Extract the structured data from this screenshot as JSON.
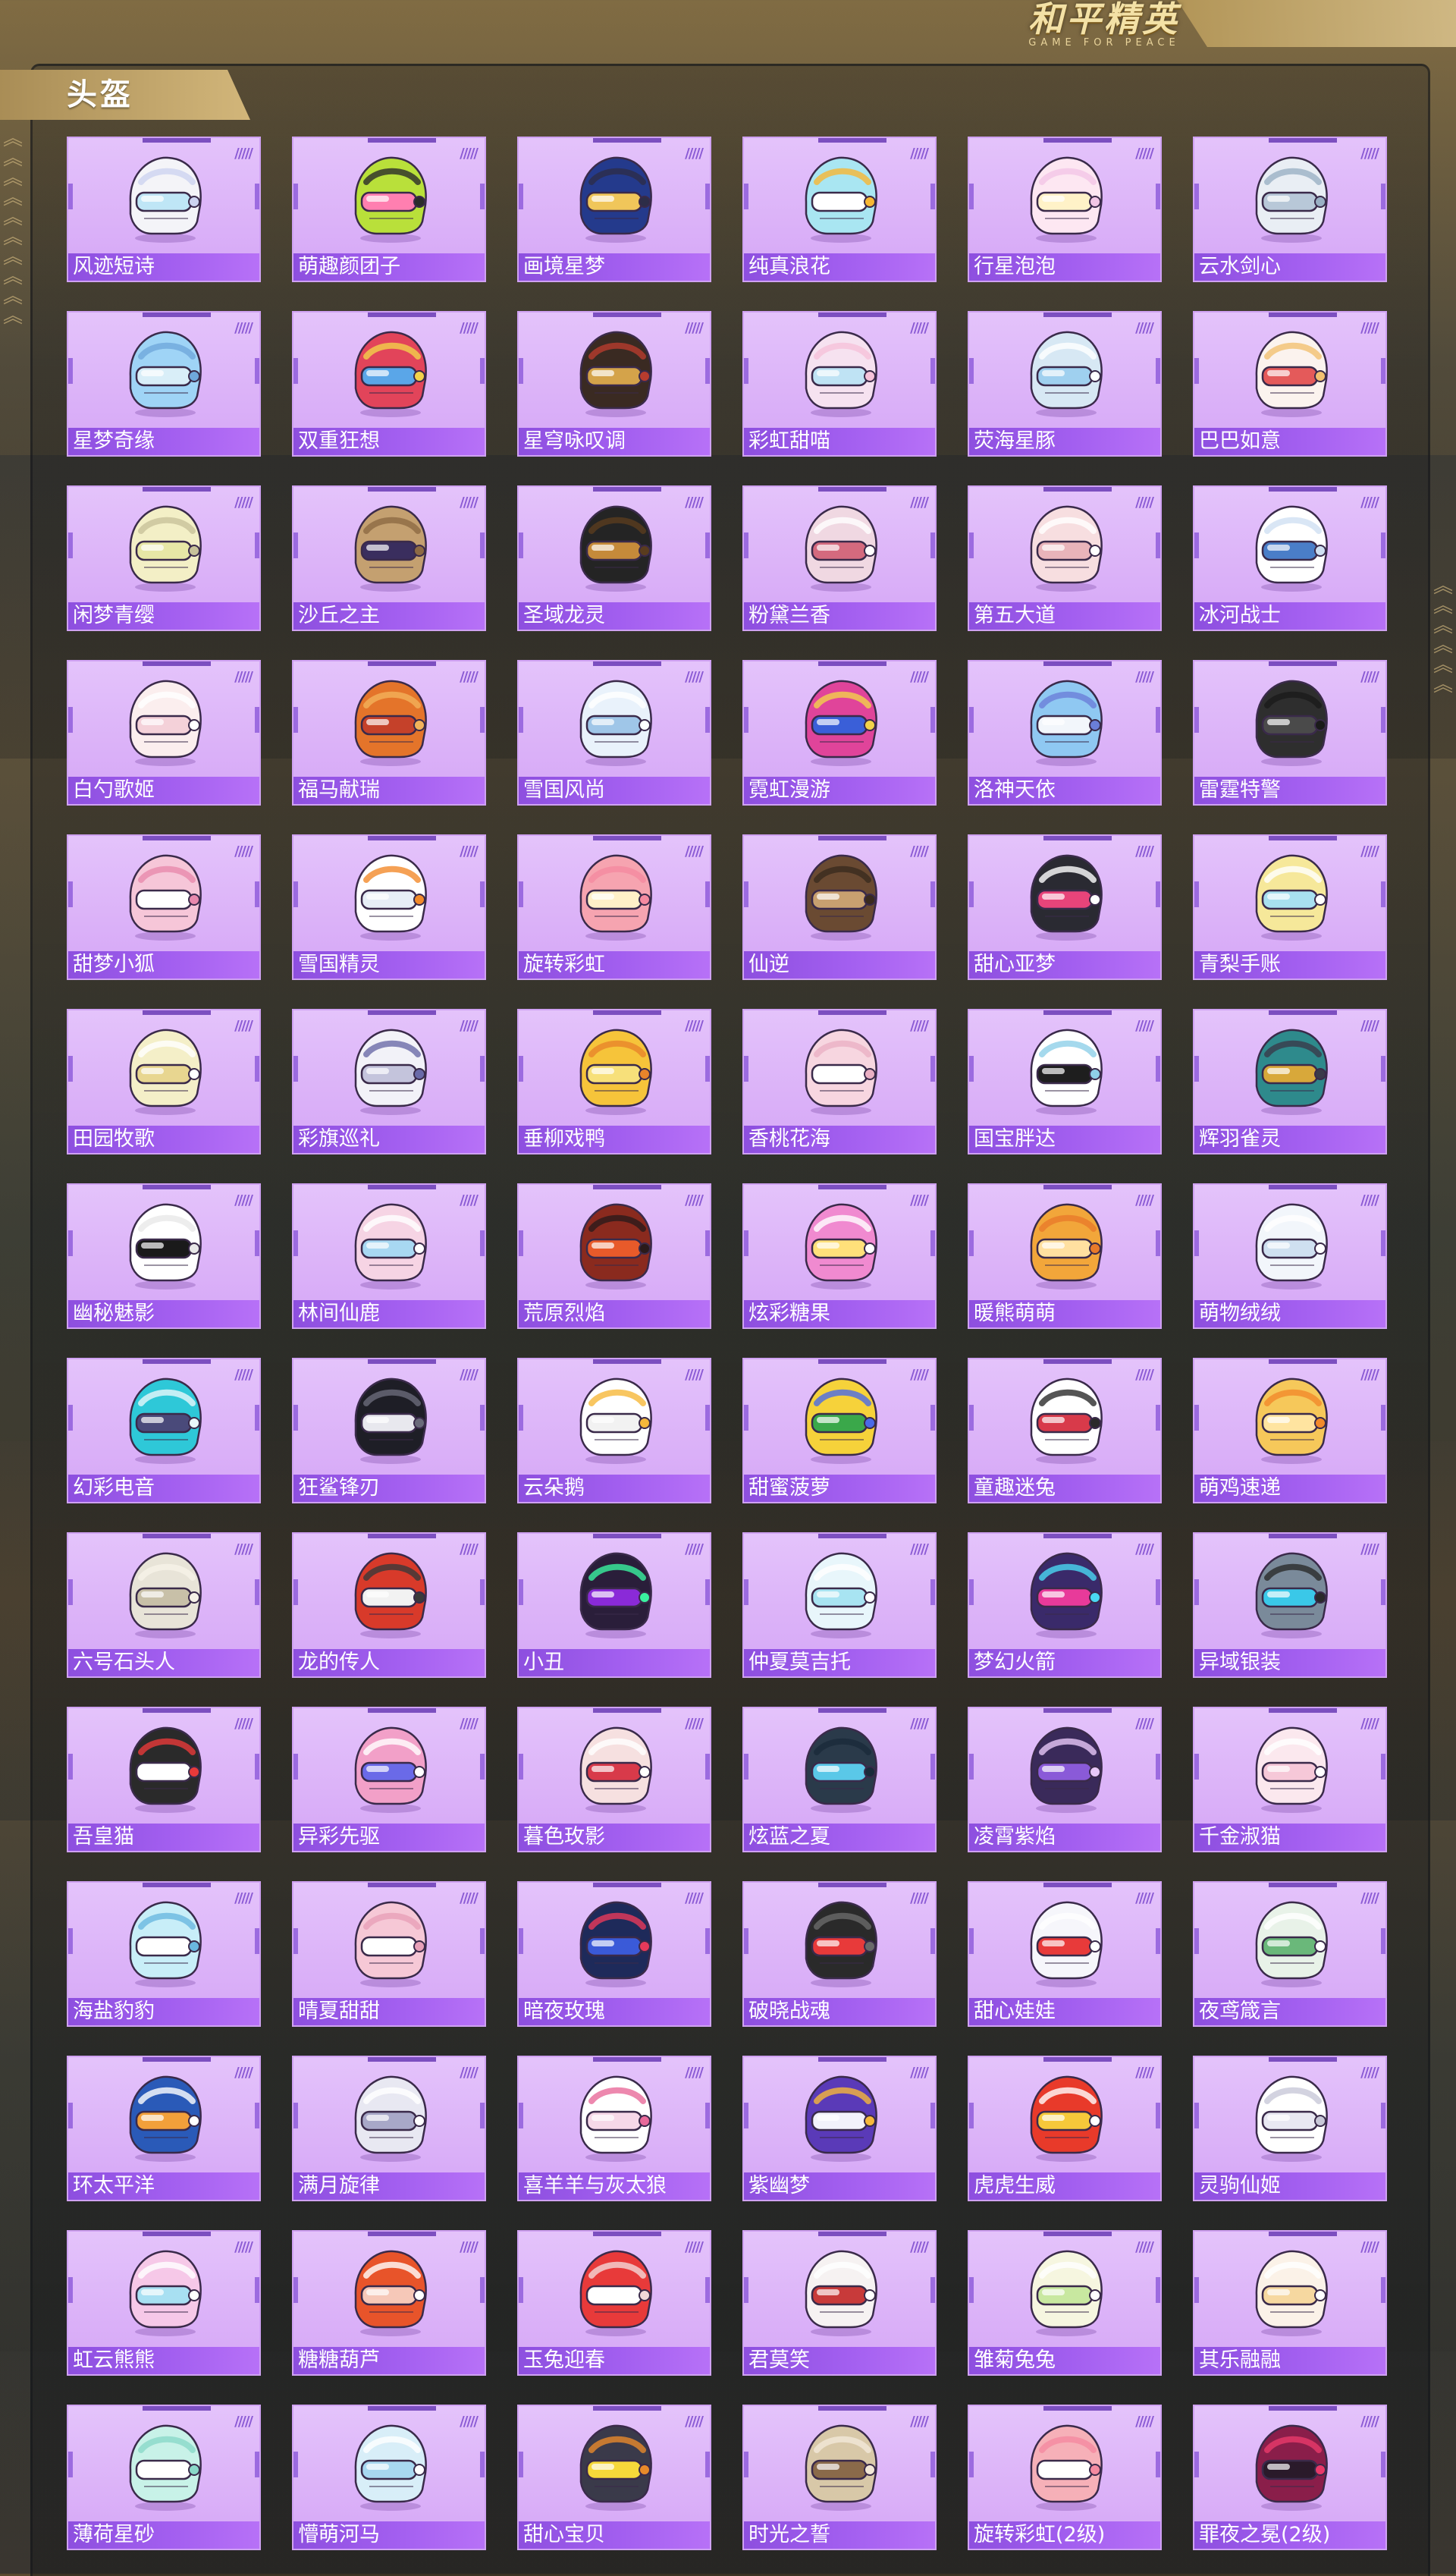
{
  "brand": {
    "name": "和平精英",
    "tagline": "GAME FOR PEACE"
  },
  "section": {
    "title": "头盔"
  },
  "colors": {
    "card_bg": "#ddb5f8",
    "label_bar": "#9a58ea",
    "accent_gold": "#c9ad72"
  },
  "items": [
    {
      "name": "风迹短诗",
      "colors": [
        "#f4f4f8",
        "#bfe6f6",
        "#cdd3f0"
      ]
    },
    {
      "name": "萌趣颜团子",
      "colors": [
        "#b9e03a",
        "#ff7fb0",
        "#2b2b2b"
      ]
    },
    {
      "name": "画境星梦",
      "colors": [
        "#243a8c",
        "#f0c65a",
        "#2d2d48"
      ]
    },
    {
      "name": "纯真浪花",
      "colors": [
        "#a9e6f2",
        "#ffffff",
        "#f7b733"
      ]
    },
    {
      "name": "行星泡泡",
      "colors": [
        "#fde7f2",
        "#fff2c8",
        "#f2c6e6"
      ]
    },
    {
      "name": "云水剑心",
      "colors": [
        "#e9eef4",
        "#b8c8d8",
        "#9ab0c4"
      ]
    },
    {
      "name": "星梦奇缘",
      "colors": [
        "#9fd4f6",
        "#d9eef8",
        "#6fa8dc"
      ]
    },
    {
      "name": "双重狂想",
      "colors": [
        "#e2445a",
        "#5aa6e8",
        "#f2d24a"
      ]
    },
    {
      "name": "星穹咏叹调",
      "colors": [
        "#3a2a22",
        "#d4a34a",
        "#b83c2e"
      ]
    },
    {
      "name": "彩虹甜喵",
      "colors": [
        "#f6e2f0",
        "#bfe3f4",
        "#f6c2d9"
      ]
    },
    {
      "name": "荧海星豚",
      "colors": [
        "#d7e8f4",
        "#9fd0ef",
        "#ffffff"
      ]
    },
    {
      "name": "巴巴如意",
      "colors": [
        "#fbf3ee",
        "#e45a5a",
        "#f2c070"
      ]
    },
    {
      "name": "闲梦青缨",
      "colors": [
        "#f3efc6",
        "#e7e7a6",
        "#c8c29a"
      ]
    },
    {
      "name": "沙丘之主",
      "colors": [
        "#c4a070",
        "#3a2e5e",
        "#8d6a44"
      ]
    },
    {
      "name": "圣域龙灵",
      "colors": [
        "#242424",
        "#c58a3a",
        "#5a3c1e"
      ]
    },
    {
      "name": "粉黛兰香",
      "colors": [
        "#f0d8e2",
        "#d46a7e",
        "#ffffff"
      ]
    },
    {
      "name": "第五大道",
      "colors": [
        "#f7dee0",
        "#e9b4ba",
        "#ffffff"
      ]
    },
    {
      "name": "冰河战士",
      "colors": [
        "#ffffff",
        "#4a7ec8",
        "#cfe0f2"
      ]
    },
    {
      "name": "白勺歌姬",
      "colors": [
        "#fbeeee",
        "#f4d1d9",
        "#ffffff"
      ]
    },
    {
      "name": "福马献瑞",
      "colors": [
        "#e4742a",
        "#c5412a",
        "#f2b25a"
      ]
    },
    {
      "name": "雪国风尚",
      "colors": [
        "#e9f2fb",
        "#9fc6e8",
        "#ffffff"
      ]
    },
    {
      "name": "霓虹漫游",
      "colors": [
        "#e0449a",
        "#3a5fd8",
        "#f2d24a"
      ]
    },
    {
      "name": "洛神天依",
      "colors": [
        "#8fc8f2",
        "#f2f6fb",
        "#6a7ed8"
      ]
    },
    {
      "name": "雷霆特警",
      "colors": [
        "#2e2e2e",
        "#4a4a4a",
        "#1a1a1a"
      ]
    },
    {
      "name": "甜梦小狐",
      "colors": [
        "#f6c6d8",
        "#ffffff",
        "#e889ad"
      ]
    },
    {
      "name": "雪国精灵",
      "colors": [
        "#ffffff",
        "#e7eef6",
        "#f28a2a"
      ]
    },
    {
      "name": "旋转彩虹",
      "colors": [
        "#f6a4b0",
        "#fff0c8",
        "#f58aa0"
      ]
    },
    {
      "name": "仙逆",
      "colors": [
        "#6a4a32",
        "#c8a070",
        "#3a2a1e"
      ]
    },
    {
      "name": "甜心亚梦",
      "colors": [
        "#2a2a32",
        "#e8447a",
        "#ffffff"
      ]
    },
    {
      "name": "青梨手账",
      "colors": [
        "#f6e89a",
        "#a8e0f0",
        "#ffffff"
      ]
    },
    {
      "name": "田园牧歌",
      "colors": [
        "#f4efc8",
        "#e8d690",
        "#ffffff"
      ]
    },
    {
      "name": "彩旗巡礼",
      "colors": [
        "#f2f2f8",
        "#c4c4dc",
        "#6a6aa8"
      ]
    },
    {
      "name": "垂柳戏鸭",
      "colors": [
        "#f6c43a",
        "#f7e07a",
        "#e8842a"
      ]
    },
    {
      "name": "香桃花海",
      "colors": [
        "#f7d6e0",
        "#ffffff",
        "#eab0c4"
      ]
    },
    {
      "name": "国宝胖达",
      "colors": [
        "#ffffff",
        "#1e1e1e",
        "#8fd0e8"
      ]
    },
    {
      "name": "辉羽雀灵",
      "colors": [
        "#2e8a8c",
        "#d8a83a",
        "#3a3a4a"
      ]
    },
    {
      "name": "幽秘魅影",
      "colors": [
        "#ffffff",
        "#1a1a1a",
        "#e8e8e8"
      ]
    },
    {
      "name": "林间仙鹿",
      "colors": [
        "#f6d4e4",
        "#a8d8f2",
        "#ffffff"
      ]
    },
    {
      "name": "荒原烈焰",
      "colors": [
        "#8a2a1e",
        "#e85a2a",
        "#2a1a1a"
      ]
    },
    {
      "name": "炫彩糖果",
      "colors": [
        "#f08ad0",
        "#ffe07a",
        "#ffffff"
      ]
    },
    {
      "name": "暖熊萌萌",
      "colors": [
        "#f2a63a",
        "#ffe0a0",
        "#e87a2a"
      ]
    },
    {
      "name": "萌物绒绒",
      "colors": [
        "#f2f6fb",
        "#cfe0f0",
        "#ffffff"
      ]
    },
    {
      "name": "幻彩电音",
      "colors": [
        "#2ec8d8",
        "#4a4a7a",
        "#e8f8fb"
      ]
    },
    {
      "name": "狂鲨锋刃",
      "colors": [
        "#1e1e26",
        "#e8e8ee",
        "#6a6a7a"
      ]
    },
    {
      "name": "云朵鹅",
      "colors": [
        "#ffffff",
        "#f2f2f2",
        "#f6b83a"
      ]
    },
    {
      "name": "甜蜜菠萝",
      "colors": [
        "#f6d23a",
        "#3aa84a",
        "#4a6ae8"
      ]
    },
    {
      "name": "童趣迷兔",
      "colors": [
        "#ffffff",
        "#d83a4a",
        "#2a2a2a"
      ]
    },
    {
      "name": "萌鸡速递",
      "colors": [
        "#f6c85a",
        "#ffe4a0",
        "#f28a2a"
      ]
    },
    {
      "name": "六号石头人",
      "colors": [
        "#e8e4d8",
        "#c8c0a8",
        "#f6f2e8"
      ]
    },
    {
      "name": "龙的传人",
      "colors": [
        "#d83a2a",
        "#f2f2f2",
        "#3a3a3a"
      ]
    },
    {
      "name": "小丑",
      "colors": [
        "#2a1e3a",
        "#8a2ad8",
        "#3af2a0"
      ]
    },
    {
      "name": "仲夏莫吉托",
      "colors": [
        "#e8f6fb",
        "#a8e4f2",
        "#ffffff"
      ]
    },
    {
      "name": "梦幻火箭",
      "colors": [
        "#3a2a6a",
        "#e83a9a",
        "#4ad8f2"
      ]
    },
    {
      "name": "异域银装",
      "colors": [
        "#7a8a9a",
        "#3ac8e8",
        "#2a2a2a"
      ]
    },
    {
      "name": "吾皇猫",
      "colors": [
        "#2a2a2a",
        "#ffffff",
        "#e83a3a"
      ]
    },
    {
      "name": "异彩先驱",
      "colors": [
        "#f2a0c8",
        "#6a6ae8",
        "#ffffff"
      ]
    },
    {
      "name": "暮色玫影",
      "colors": [
        "#f6e0e0",
        "#d83a4a",
        "#ffffff"
      ]
    },
    {
      "name": "炫蓝之夏",
      "colors": [
        "#2a3a4a",
        "#5ac8e8",
        "#1a2a3a"
      ]
    },
    {
      "name": "凌霄紫焰",
      "colors": [
        "#3a2a5a",
        "#8a5ad8",
        "#e8c8f8"
      ]
    },
    {
      "name": "千金淑猫",
      "colors": [
        "#fbe8ee",
        "#f6c8d8",
        "#ffffff"
      ]
    },
    {
      "name": "海盐豹豹",
      "colors": [
        "#c8eef8",
        "#ffffff",
        "#6ab8e0"
      ]
    },
    {
      "name": "晴夏甜甜",
      "colors": [
        "#f6c8d6",
        "#ffffff",
        "#e8a0b8"
      ]
    },
    {
      "name": "暗夜玫瑰",
      "colors": [
        "#1e2a5a",
        "#3a5ad8",
        "#e83a5a"
      ]
    },
    {
      "name": "破晓战魂",
      "colors": [
        "#2a2a2a",
        "#e83a3a",
        "#6a6a6a"
      ]
    },
    {
      "name": "甜心娃娃",
      "colors": [
        "#f6f6fb",
        "#e83a3a",
        "#ffffff"
      ]
    },
    {
      "name": "夜鸢箴言",
      "colors": [
        "#e8f2e8",
        "#6ab87a",
        "#ffffff"
      ]
    },
    {
      "name": "环太平洋",
      "colors": [
        "#2a5ab8",
        "#f2a03a",
        "#ffffff"
      ]
    },
    {
      "name": "满月旋律",
      "colors": [
        "#e8e8f2",
        "#a8a8c8",
        "#ffffff"
      ]
    },
    {
      "name": "喜羊羊与灰太狼",
      "colors": [
        "#ffffff",
        "#f6d8e8",
        "#e86a9a"
      ]
    },
    {
      "name": "紫幽梦",
      "colors": [
        "#5a3ab8",
        "#f2f2fb",
        "#f6b83a"
      ]
    },
    {
      "name": "虎虎生威",
      "colors": [
        "#e83a2a",
        "#f6c83a",
        "#ffffff"
      ]
    },
    {
      "name": "灵驹仙姬",
      "colors": [
        "#ffffff",
        "#e8e8f2",
        "#c8c8d8"
      ]
    },
    {
      "name": "虹云熊熊",
      "colors": [
        "#f6c8e8",
        "#a8e0f2",
        "#ffffff"
      ]
    },
    {
      "name": "糖糖葫芦",
      "colors": [
        "#e8542a",
        "#f6c8b8",
        "#ffffff"
      ]
    },
    {
      "name": "玉兔迎春",
      "colors": [
        "#e83a3a",
        "#ffffff",
        "#f2d8d8"
      ]
    },
    {
      "name": "君莫笑",
      "colors": [
        "#f6f2f2",
        "#c83a3a",
        "#ffffff"
      ]
    },
    {
      "name": "雏菊兔兔",
      "colors": [
        "#f6f6e0",
        "#c8e8a0",
        "#ffffff"
      ]
    },
    {
      "name": "其乐融融",
      "colors": [
        "#fbf2e8",
        "#f6d8a0",
        "#ffffff"
      ]
    },
    {
      "name": "薄荷星砂",
      "colors": [
        "#c8f2e8",
        "#ffffff",
        "#8ad8c8"
      ]
    },
    {
      "name": "懵萌河马",
      "colors": [
        "#d8eef8",
        "#a8d8f0",
        "#ffffff"
      ]
    },
    {
      "name": "甜心宝贝",
      "colors": [
        "#3a3a4a",
        "#f6d83a",
        "#e88a2a"
      ]
    },
    {
      "name": "时光之誓",
      "colors": [
        "#d8c8a8",
        "#8a6a4a",
        "#f2e8d8"
      ]
    },
    {
      "name": "旋转彩虹(2级)",
      "colors": [
        "#f6b0b8",
        "#ffffff",
        "#f58aa0"
      ]
    },
    {
      "name": "罪夜之冕(2级)",
      "colors": [
        "#8a1e4a",
        "#2a1a2a",
        "#e83a6a"
      ]
    }
  ]
}
